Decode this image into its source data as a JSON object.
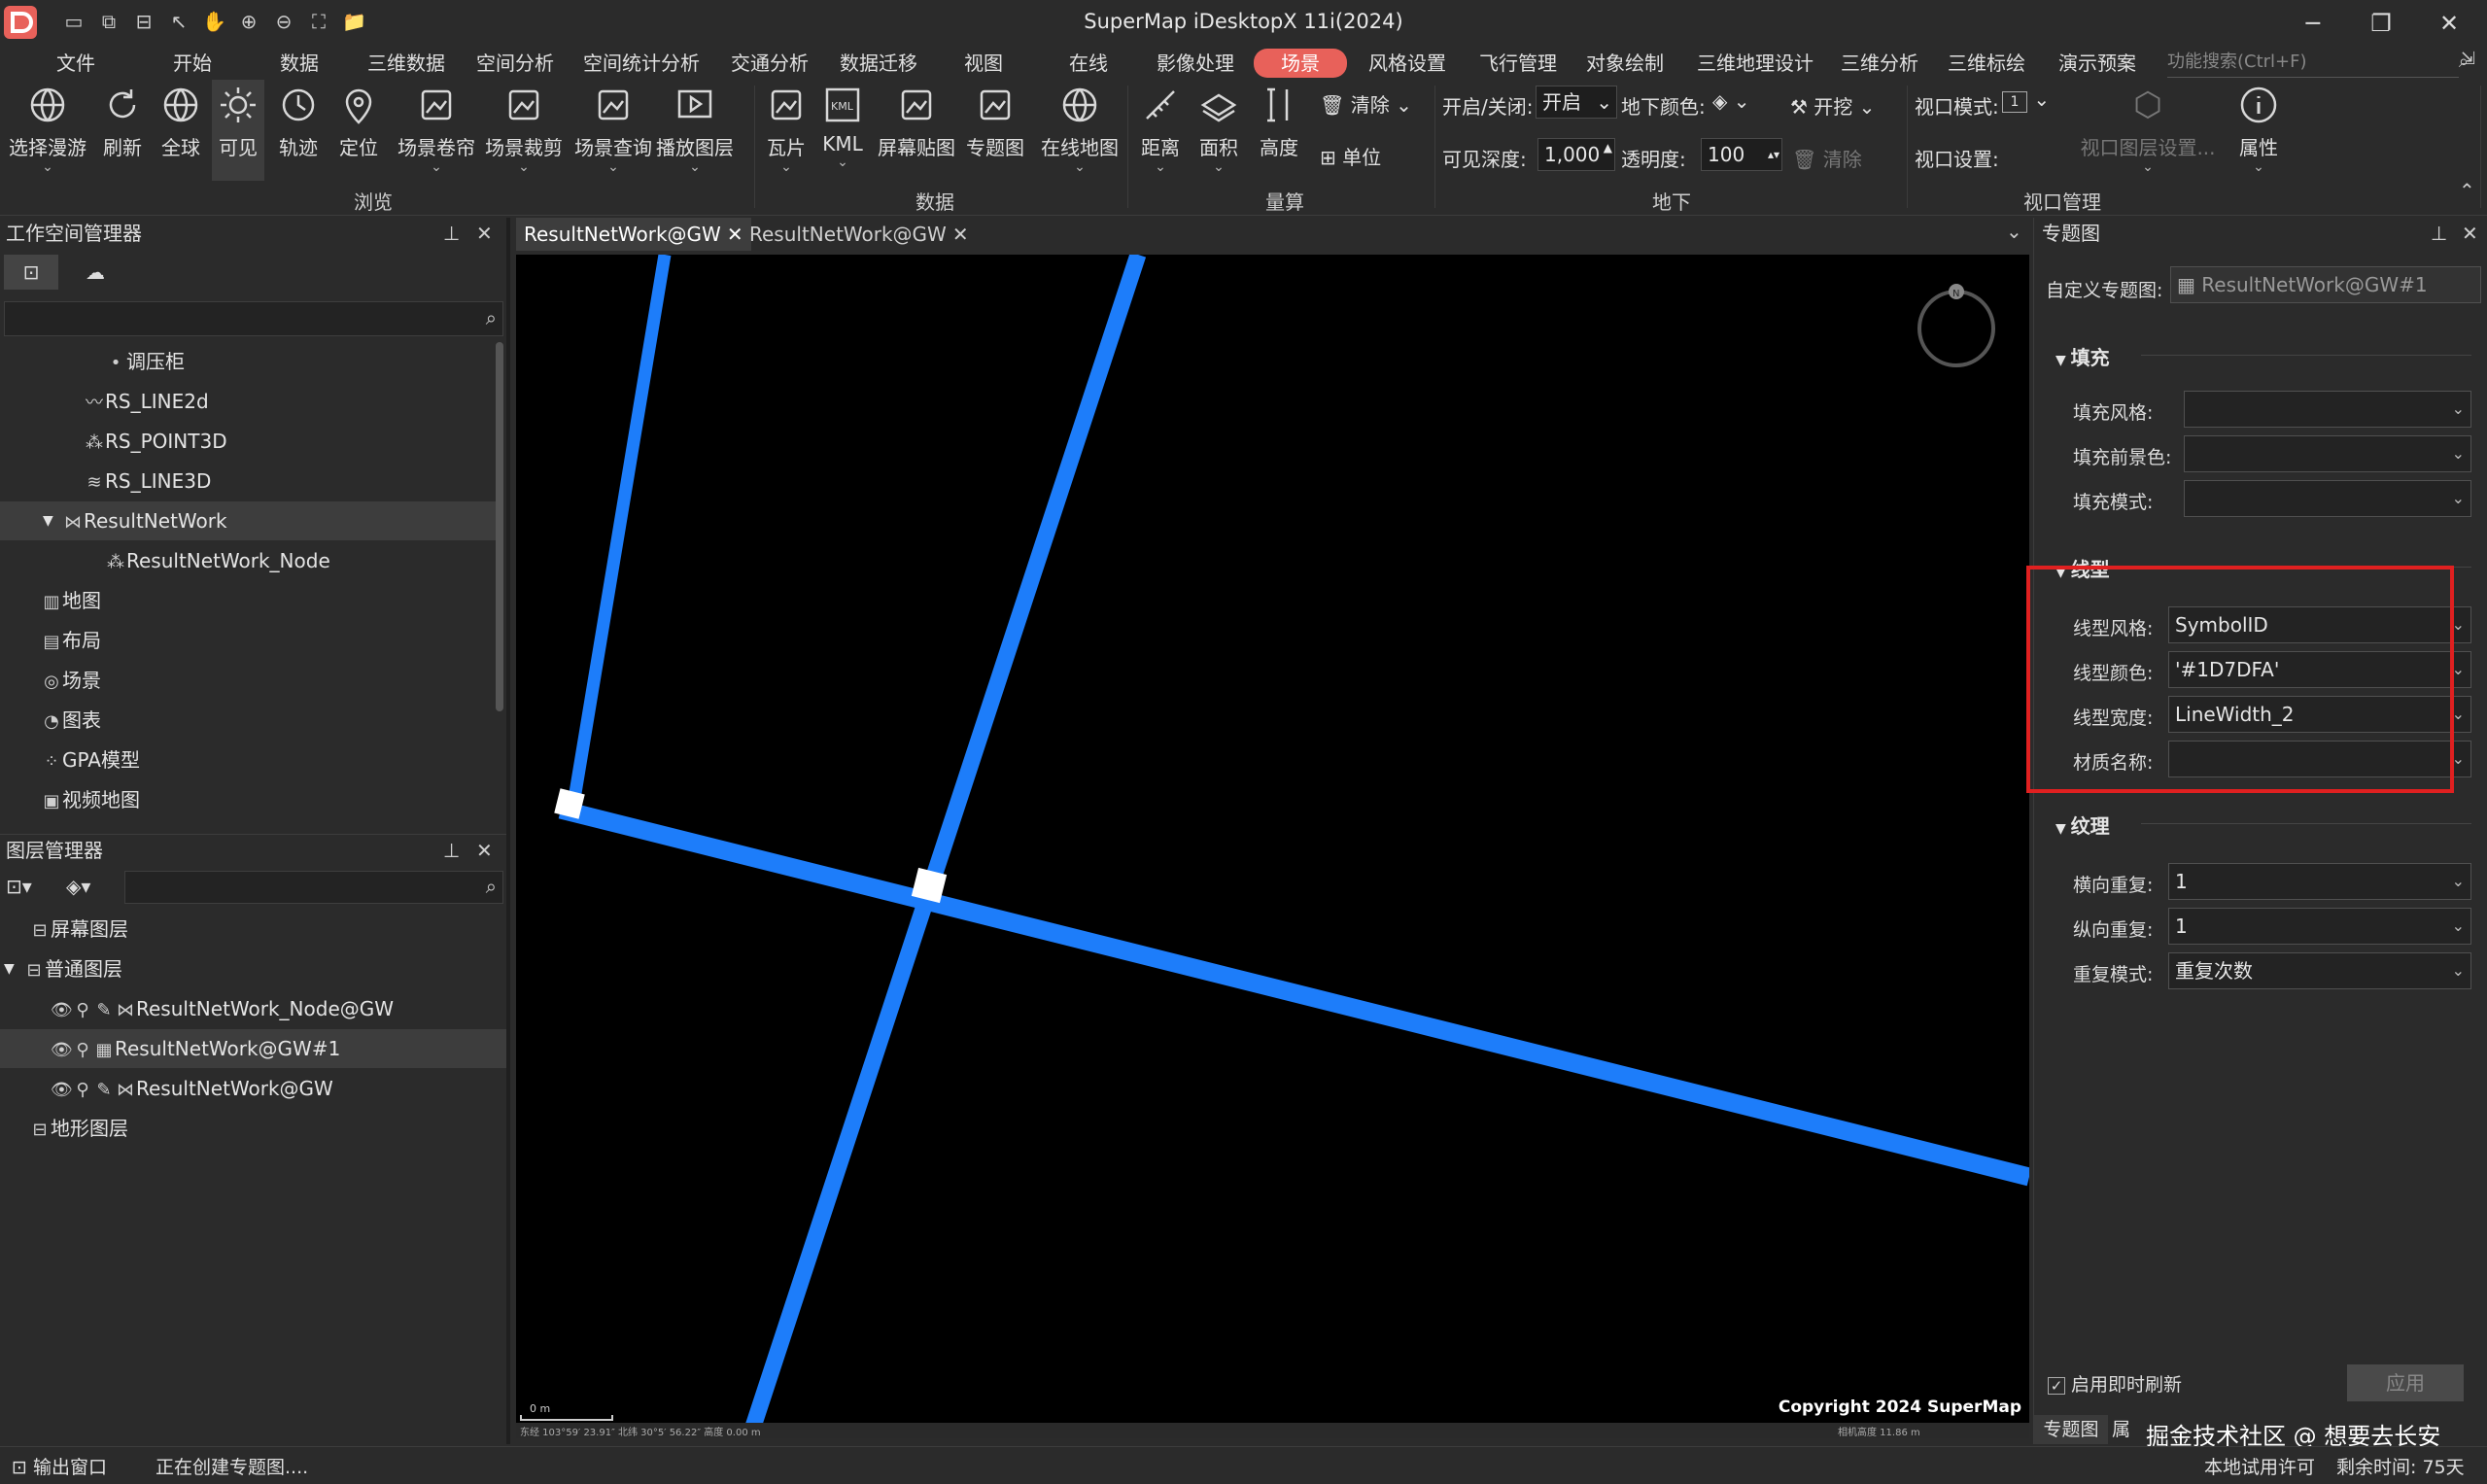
{
  "window": {
    "title": "SuperMap iDesktopX 11i(2024)"
  },
  "menu": [
    "文件",
    "开始",
    "数据",
    "三维数据",
    "空间分析",
    "空间统计分析",
    "交通分析",
    "数据迁移",
    "视图",
    "在线",
    "影像处理",
    "场景",
    "风格设置",
    "飞行管理",
    "对象绘制",
    "三维地理设计",
    "三维分析",
    "三维标绘",
    "演示预案"
  ],
  "function_search": {
    "placeholder": "功能搜索(Ctrl+F)"
  },
  "ribbon": {
    "browse": [
      "选择漫游",
      "刷新",
      "全球",
      "可见",
      "轨迹",
      "定位",
      "场景卷帘",
      "场景裁剪",
      "场景查询",
      "播放图层"
    ],
    "data": [
      "瓦片",
      "KML",
      "屏幕贴图",
      "专题图",
      "在线地图"
    ],
    "measure": [
      "距离",
      "面积",
      "高度",
      "清除",
      "单位"
    ],
    "underground": {
      "toggle_label": "开启/关闭:",
      "toggle_value": "开启",
      "ground_color_label": "地下颜色:",
      "excavate": "开挖",
      "depth_label": "可见深度:",
      "depth_value": "1,000",
      "transparency_label": "透明度:",
      "transparency_value": "100",
      "clear": "清除"
    },
    "viewport": {
      "mode_label": "视口模式:",
      "mode_value": "1",
      "settings_label": "视口设置:",
      "layer_settings": "视口图层设置...",
      "properties": "属性"
    },
    "group_labels": [
      "浏览",
      "数据",
      "量算",
      "地下",
      "视口管理"
    ]
  },
  "workspace_panel": {
    "title": "工作空间管理器",
    "items": [
      {
        "label": "调压柜",
        "icon": "point-icon",
        "indent": 4
      },
      {
        "label": "RS_LINE2d",
        "icon": "line-icon",
        "indent": 3
      },
      {
        "label": "RS_POINT3D",
        "icon": "point3d-icon",
        "indent": 3
      },
      {
        "label": "RS_LINE3D",
        "icon": "line3d-icon",
        "indent": 3
      },
      {
        "label": "ResultNetWork",
        "icon": "network-icon",
        "indent": 2,
        "expanded": true,
        "selected": true
      },
      {
        "label": "ResultNetWork_Node",
        "icon": "point3d-icon",
        "indent": 4
      },
      {
        "label": "地图",
        "icon": "map-icon",
        "indent": 1
      },
      {
        "label": "布局",
        "icon": "layout-icon",
        "indent": 1
      },
      {
        "label": "场景",
        "icon": "globe-icon",
        "indent": 1
      },
      {
        "label": "图表",
        "icon": "chart-icon",
        "indent": 1
      },
      {
        "label": "GPA模型",
        "icon": "gpa-icon",
        "indent": 1
      },
      {
        "label": "视频地图",
        "icon": "video-icon",
        "indent": 1
      }
    ]
  },
  "layer_panel": {
    "title": "图层管理器",
    "items": [
      {
        "label": "屏幕图层",
        "indent": 1,
        "group": true
      },
      {
        "label": "普通图层",
        "indent": 0,
        "group": true,
        "expanded": true
      },
      {
        "label": "ResultNetWork_Node@GW",
        "indent": 2
      },
      {
        "label": "ResultNetWork@GW#1",
        "indent": 2,
        "selected": true
      },
      {
        "label": "ResultNetWork@GW",
        "indent": 2
      },
      {
        "label": "地形图层",
        "indent": 1,
        "group": true
      }
    ]
  },
  "doc_tabs": [
    {
      "label": "ResultNetWork@GW",
      "active": true
    },
    {
      "label": "ResultNetWork@GW",
      "active": false
    }
  ],
  "map": {
    "copyright": "Copyright 2024 SuperMap",
    "scale_text": "0 m",
    "coords_text": "东经 103°59′ 23.91″  北纬 30°5′ 56.22″  高度 0.00 m",
    "camera_text": "相机高度 11.86 m",
    "line_color": "#1D7DFA"
  },
  "thematic_panel": {
    "title": "专题图",
    "custom_label": "自定义专题图:",
    "custom_value": "ResultNetWork@GW#1",
    "fill_section": "填充",
    "fill_fields": [
      {
        "label": "填充风格:",
        "value": ""
      },
      {
        "label": "填充前景色:",
        "value": ""
      },
      {
        "label": "填充模式:",
        "value": ""
      }
    ],
    "line_section": "线型",
    "line_fields": [
      {
        "label": "线型风格:",
        "value": "SymbolID"
      },
      {
        "label": "线型颜色:",
        "value": "'#1D7DFA'"
      },
      {
        "label": "线型宽度:",
        "value": "LineWidth_2"
      },
      {
        "label": "材质名称:",
        "value": ""
      }
    ],
    "texture_section": "纹理",
    "texture_fields": [
      {
        "label": "横向重复:",
        "value": "1"
      },
      {
        "label": "纵向重复:",
        "value": "1"
      },
      {
        "label": "重复模式:",
        "value": "重复次数"
      }
    ],
    "instant_refresh": "启用即时刷新",
    "apply": "应用",
    "bottom_tabs": [
      "专题图",
      "属"
    ],
    "highlight_color": "#e02020"
  },
  "watermark": "掘金技术社区 @ 想要去长安",
  "status": {
    "output_window": "输出窗口",
    "message": "正在创建专题图....",
    "license": "本地试用许可",
    "remaining": "剩余时间: 75天"
  }
}
